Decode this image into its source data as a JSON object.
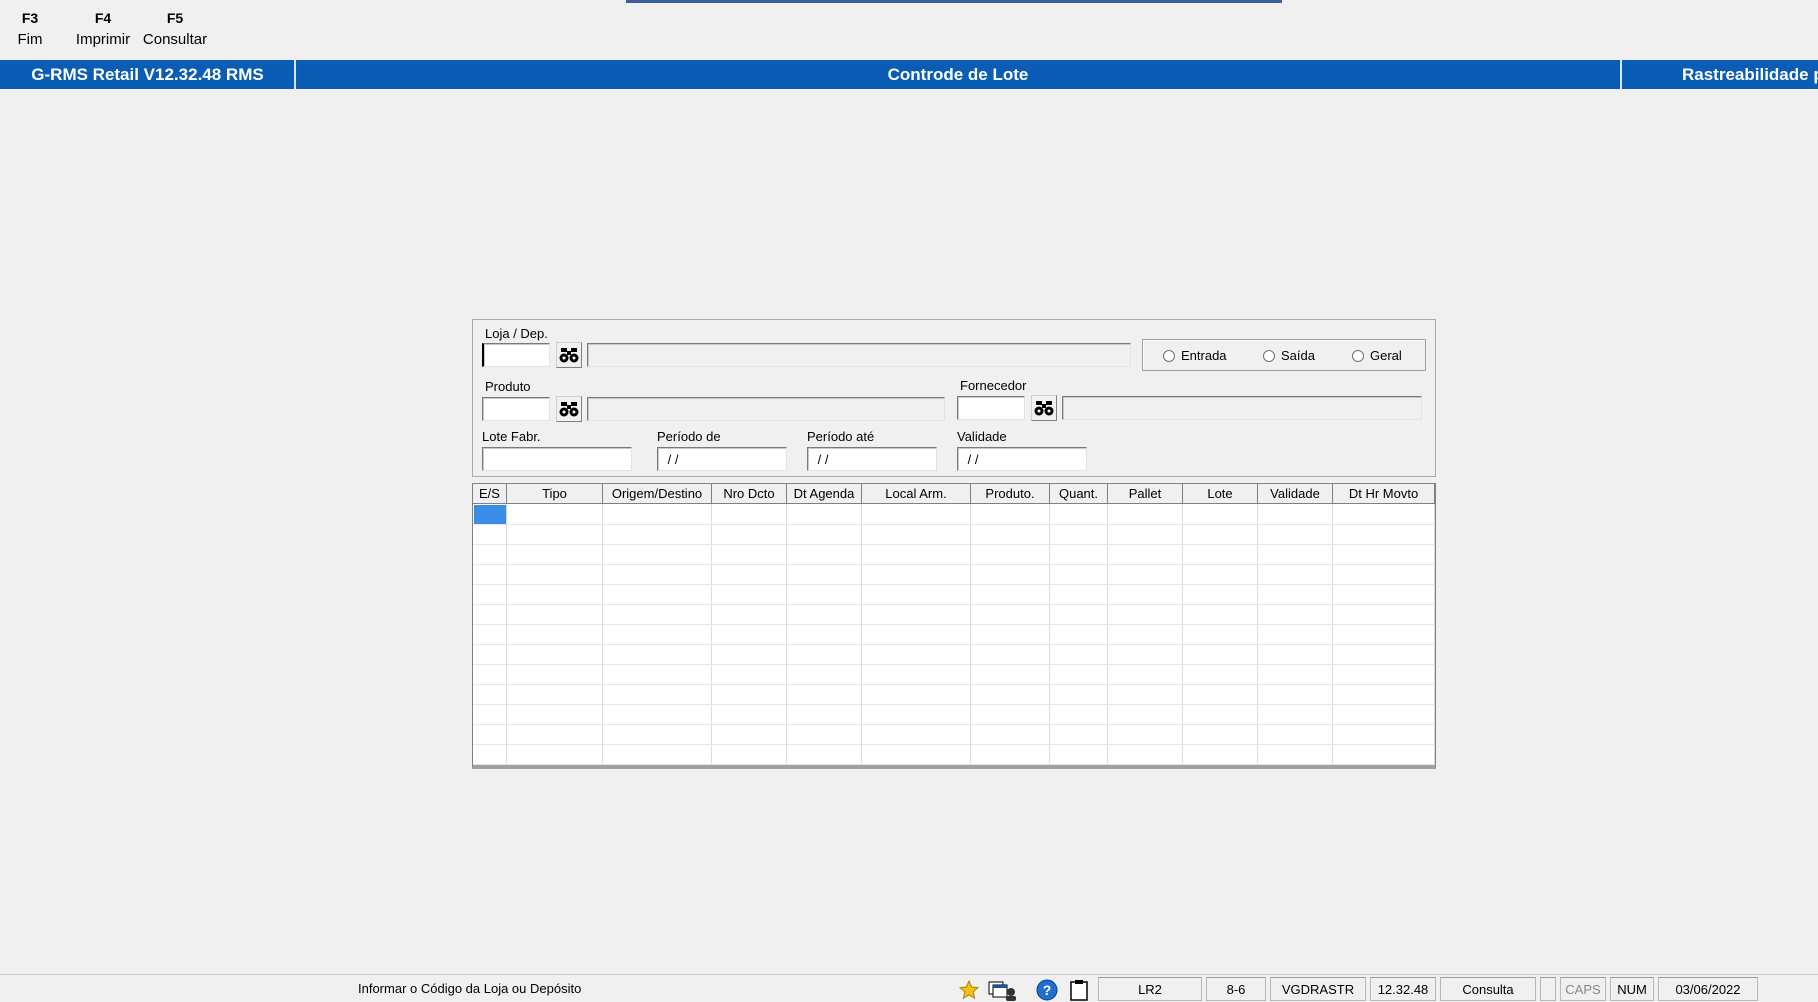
{
  "function_keys": [
    {
      "key": "F3",
      "label": "Fim"
    },
    {
      "key": "F4",
      "label": "Imprimir"
    },
    {
      "key": "F5",
      "label": "Consultar"
    }
  ],
  "titlebar": {
    "left": "G-RMS Retail V12.32.48 RMS",
    "center": "Controde de Lote",
    "right": "Rastreabilidade p"
  },
  "form": {
    "loja_label": "Loja / Dep.",
    "produto_label": "Produto",
    "fornecedor_label": "Fornecedor",
    "lote_label": "Lote Fabr.",
    "periodo_de_label": "Período de",
    "periodo_ate_label": "Período até",
    "validade_label": "Validade",
    "periodo_de_value": " / /",
    "periodo_ate_value": " / /",
    "validade_value": " / /",
    "radio_options": [
      "Entrada",
      "Saída",
      "Geral"
    ]
  },
  "grid": {
    "columns": [
      "E/S",
      "Tipo",
      "Origem/Destino",
      "Nro Dcto",
      "Dt Agenda",
      "Local Arm.",
      "Produto.",
      "Quant.",
      "Pallet",
      "Lote",
      "Validade",
      "Dt Hr Movto"
    ]
  },
  "statusbar": {
    "message": "Informar o Código da Loja ou Depósito",
    "fields": [
      "LR2",
      "8-6",
      "VGDRASTR",
      "12.32.48",
      "Consulta",
      "CAPS",
      "NUM",
      "03/06/2022"
    ]
  },
  "colors": {
    "titlebar": "#0a5cb4",
    "selection": "#3a8ee6",
    "background": "#f0f0f0"
  }
}
